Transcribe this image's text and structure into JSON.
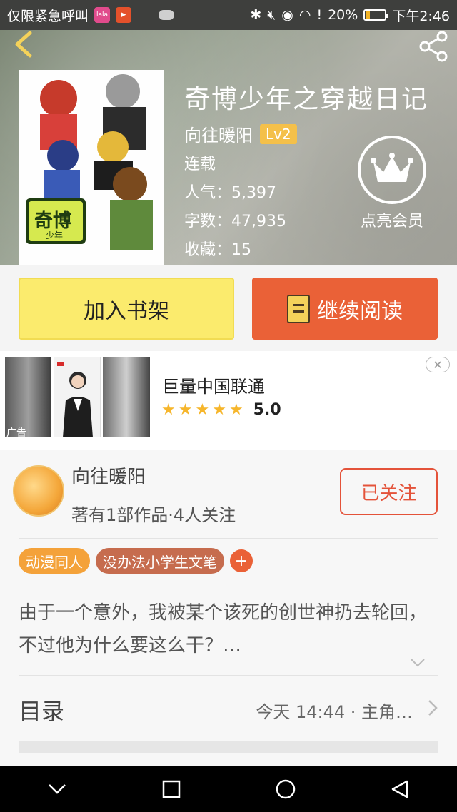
{
  "status_bar": {
    "left_text": "仅限紧急呼叫",
    "app_badges": [
      "lala",
      "▶"
    ],
    "battery_percent": "20%",
    "battery_level": 0.2,
    "time": "下午2:46"
  },
  "hero": {
    "book_title": "奇博少年之穿越日记",
    "author": "向往暖阳",
    "author_level": "Lv2",
    "status": "连载",
    "popularity_label": "人气：5,397",
    "word_count_label": "字数：47,935",
    "favorites_label": "收藏：15",
    "vip_label": "点亮会员"
  },
  "actions": {
    "add_shelf_label": "加入书架",
    "continue_reading_label": "继续阅读"
  },
  "ad": {
    "tag": "广告",
    "title": "巨量中国联通",
    "rating": "5.0",
    "stars": 5
  },
  "author_section": {
    "name": "向往暖阳",
    "stats": "著有1部作品·4人关注",
    "follow_label": "已关注",
    "tags": [
      "动漫同人",
      "没办法小学生文笔"
    ],
    "description": "由于一个意外，我被某个该死的创世神扔去轮回，不过他为什么要这么干？…",
    "toc_label": "目录",
    "toc_latest": "今天 14:44 · 主角…"
  },
  "colors": {
    "accent_orange": "#ea6137",
    "shelf_yellow": "#fbeb6d",
    "tag_orange": "#f4a23a",
    "tag_brown": "#c66c4e"
  }
}
